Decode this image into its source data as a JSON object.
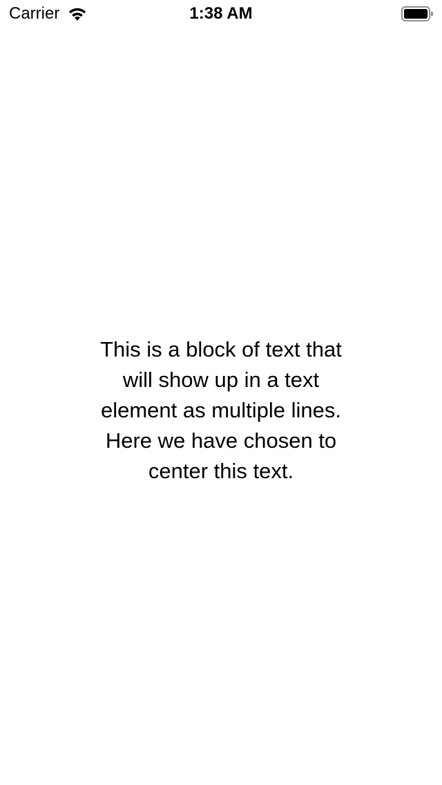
{
  "status_bar": {
    "carrier": "Carrier",
    "time": "1:38 AM",
    "wifi_icon": "wifi-icon",
    "battery_icon": "battery-icon"
  },
  "main": {
    "text": "This is a block of text that\nwill show up in a text\nelement as multiple lines.\n Here we have chosen to\ncenter this text."
  }
}
